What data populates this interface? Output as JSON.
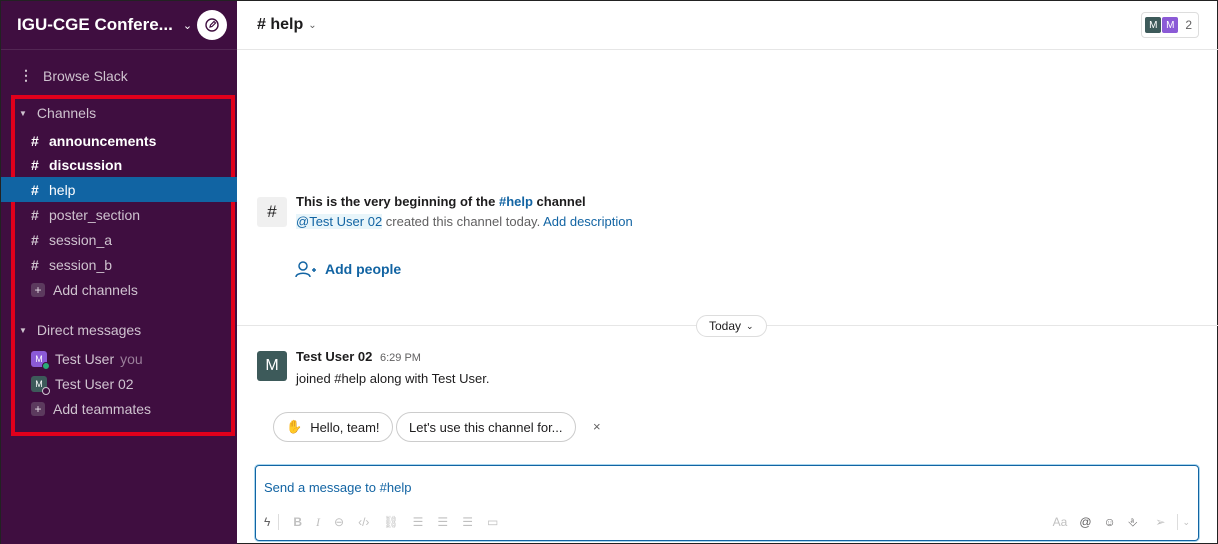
{
  "workspace": {
    "name": "IGU-CGE Confere..."
  },
  "sidebar": {
    "browse": "Browse Slack",
    "channels_header": "Channels",
    "channels": [
      {
        "name": "announcements"
      },
      {
        "name": "discussion"
      },
      {
        "name": "help"
      },
      {
        "name": "poster_section"
      },
      {
        "name": "session_a"
      },
      {
        "name": "session_b"
      }
    ],
    "add_channels": "Add channels",
    "dm_header": "Direct messages",
    "dms": [
      {
        "initial": "M",
        "name": "Test User",
        "suffix": "you"
      },
      {
        "initial": "M",
        "name": "Test User 02"
      }
    ],
    "add_teammates": "Add teammates"
  },
  "topbar": {
    "channel": "# help",
    "member_avatars": [
      "M",
      "M"
    ],
    "member_count": "2"
  },
  "intro": {
    "hash": "#",
    "line1_prefix": "This is the very beginning of the ",
    "line1_channel": "#help",
    "line1_suffix": " channel",
    "creator": "@Test User 02",
    "created_text": " created this channel today. ",
    "add_description": "Add description"
  },
  "add_people": "Add people",
  "date_divider": "Today",
  "message": {
    "avatar": "M",
    "author": "Test User 02",
    "time": "6:29 PM",
    "text": "joined #help along with Test User."
  },
  "suggestions": [
    {
      "label": "Hello, team!"
    },
    {
      "label": "Let's use this channel for..."
    }
  ],
  "suggestion_close": "×",
  "composer": {
    "placeholder": "Send a message to #help",
    "format_label": "Aa"
  },
  "colors": {
    "sidebar_bg": "#3f0e40",
    "active_item": "#1164a3",
    "link": "#1264a3",
    "highlight_box": "#e0001b"
  }
}
